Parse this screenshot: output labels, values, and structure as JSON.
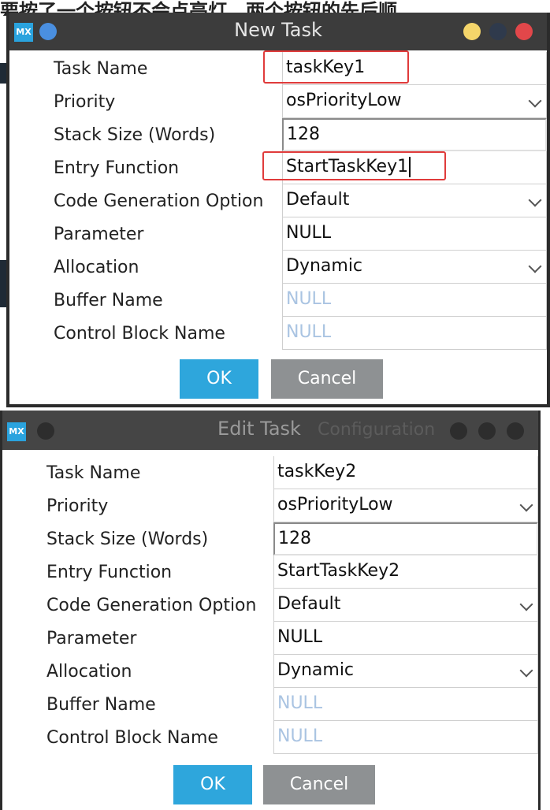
{
  "background_text": "要按了一个按钮不会点亮灯，两个按钮的先后顺",
  "icons": {
    "logo": "MX"
  },
  "colors": {
    "accent": "#2ea6dc",
    "cancel": "#8e9193",
    "highlight": "#e03b3b",
    "titlebar": "#3c3c3c"
  },
  "new_task": {
    "title": "New Task",
    "fields": [
      {
        "label": "Task Name",
        "value": "taskKey1"
      },
      {
        "label": "Priority",
        "value": "osPriorityLow"
      },
      {
        "label": "Stack Size (Words)",
        "value": "128"
      },
      {
        "label": "Entry Function",
        "value": "StartTaskKey1"
      },
      {
        "label": "Code Generation Option",
        "value": "Default"
      },
      {
        "label": "Parameter",
        "value": "NULL"
      },
      {
        "label": "Allocation",
        "value": "Dynamic"
      },
      {
        "label": "Buffer Name",
        "value": "NULL"
      },
      {
        "label": "Control Block Name",
        "value": "NULL"
      }
    ],
    "ok_label": "OK",
    "cancel_label": "Cancel"
  },
  "edit_task": {
    "title": "Edit Task",
    "ghost_title": "Configuration",
    "fields": [
      {
        "label": "Task Name",
        "value": "taskKey2"
      },
      {
        "label": "Priority",
        "value": "osPriorityLow"
      },
      {
        "label": "Stack Size (Words)",
        "value": "128"
      },
      {
        "label": "Entry Function",
        "value": "StartTaskKey2"
      },
      {
        "label": "Code Generation Option",
        "value": "Default"
      },
      {
        "label": "Parameter",
        "value": "NULL"
      },
      {
        "label": "Allocation",
        "value": "Dynamic"
      },
      {
        "label": "Buffer Name",
        "value": "NULL"
      },
      {
        "label": "Control Block Name",
        "value": "NULL"
      }
    ],
    "ok_label": "OK",
    "cancel_label": "Cancel"
  }
}
